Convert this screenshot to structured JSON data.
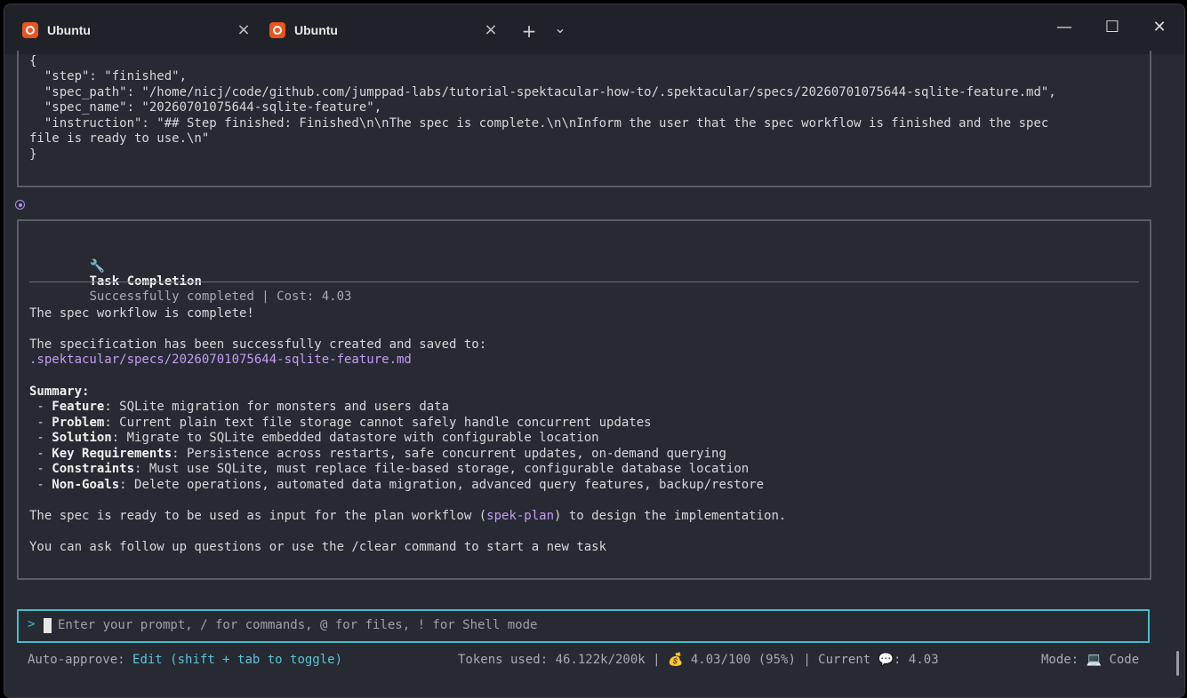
{
  "tabs": [
    {
      "label": "Ubuntu",
      "active": true
    },
    {
      "label": "Ubuntu",
      "active": false
    }
  ],
  "tabbar": {
    "close_icon": "×",
    "new_tab_icon": "+",
    "dropdown_icon": "⌄"
  },
  "window_controls": {
    "minimize": "—",
    "maximize": "☐",
    "close": "✕"
  },
  "json_output": {
    "open": "{",
    "step": "  \"step\": \"finished\",",
    "spec_path": "  \"spec_path\": \"/home/nicj/code/github.com/jumppad-labs/tutorial-spektacular-how-to/.spektacular/specs/20260701075644-sqlite-feature.md\",",
    "spec_name": "  \"spec_name\": \"20260701075644-sqlite-feature\",",
    "instruction_1": "  \"instruction\": \"## Step finished: Finished\\n\\nThe spec is complete.\\n\\nInform the user that the spec workflow is finished and the spec",
    "instruction_2": "file is ready to use.\\n\"",
    "close": "}"
  },
  "completion": {
    "icon": "wrench-icon",
    "title": "Task Completion",
    "status": "Successfully completed | Cost: 4.03",
    "line_complete": "The spec workflow is complete!",
    "saved_intro": "The specification has been successfully created and saved to:",
    "saved_path": ".spektacular/specs/20260701075644-sqlite-feature.md",
    "summary_title": "Summary:",
    "summary": [
      {
        "key": "Feature",
        "value": ": SQLite migration for monsters and users data"
      },
      {
        "key": "Problem",
        "value": ": Current plain text file storage cannot safely handle concurrent updates"
      },
      {
        "key": "Solution",
        "value": ": Migrate to SQLite embedded datastore with configurable location"
      },
      {
        "key": "Key Requirements",
        "value": ": Persistence across restarts, safe concurrent updates, on-demand querying"
      },
      {
        "key": "Constraints",
        "value": ": Must use SQLite, must replace file-based storage, configurable database location"
      },
      {
        "key": "Non-Goals",
        "value": ": Delete operations, automated data migration, advanced query features, backup/restore"
      }
    ],
    "ready_pre": "The spec is ready to be used as input for the plan workflow (",
    "ready_cmd": "spek-plan",
    "ready_post": ") to design the implementation.",
    "followup": "You can ask follow up questions or use the /clear command to start a new task"
  },
  "prompt": {
    "caret": ">",
    "placeholder": "Enter your prompt, / for commands, @ for files, ! for Shell mode"
  },
  "status_bar": {
    "auto_approve_label": "Auto-approve: ",
    "auto_approve_value": "Edit (shift + tab to toggle)",
    "tokens": "Tokens used: 46.122k/200k | ",
    "money_icon": "💰",
    "cost": " 4.03/100 (95%) | Current ",
    "chat_icon": "💬",
    "current": ": 4.03",
    "mode_label": "Mode: ",
    "mode_icon": "💻",
    "mode_value": " Code"
  },
  "colors": {
    "accent_cyan": "#3fc0cc",
    "accent_purple": "#c59cf4",
    "ubuntu_orange": "#e95420"
  }
}
